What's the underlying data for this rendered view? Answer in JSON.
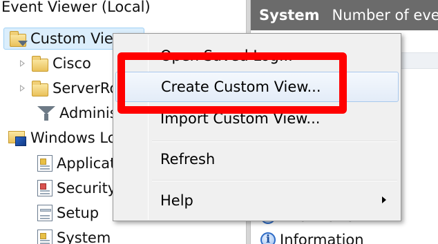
{
  "tree": {
    "root_label": "Event Viewer (Local)",
    "custom_views_label": "Custom Views",
    "cisco_label": "Cisco",
    "serverroles_label": "ServerRoles",
    "admin_label": "Administrative Events",
    "windows_logs_label": "Windows Logs",
    "application_label": "Application",
    "security_label": "Security",
    "setup_label": "Setup",
    "system_label": "System"
  },
  "right_pane": {
    "header_title": "System",
    "header_subtitle": "Number of events",
    "row_information_1": "Information",
    "row_information_2": "Information"
  },
  "context_menu": {
    "items": [
      {
        "label": "Open Saved Log..."
      },
      {
        "label": "Create Custom View..."
      },
      {
        "label": "Import Custom View..."
      },
      {
        "label": "Refresh"
      },
      {
        "label": "Help"
      }
    ]
  },
  "colors": {
    "highlight": "#ff0000",
    "selection": "#dbeefc",
    "header": "#6b6b6b"
  }
}
